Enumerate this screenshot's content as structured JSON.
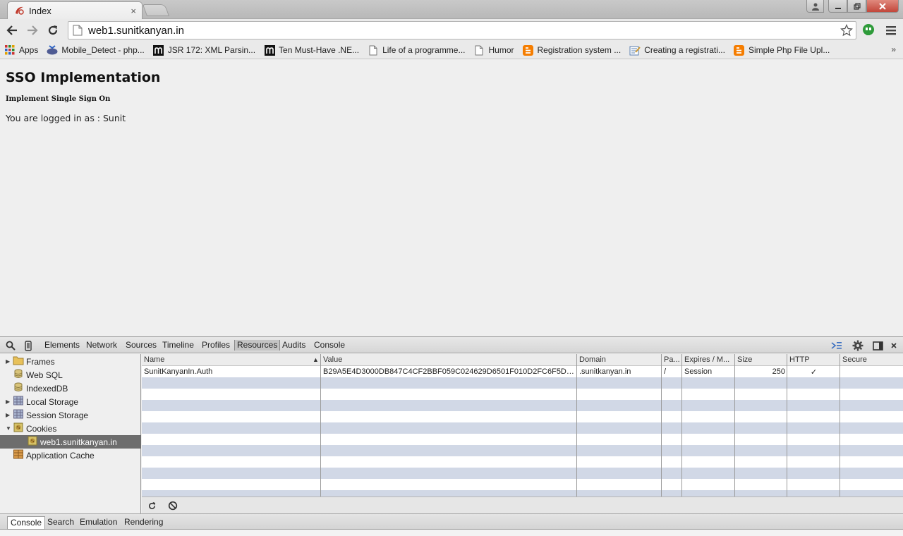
{
  "browser": {
    "tab_title": "Index",
    "tab_close": "×",
    "url": "web1.sunitkanyan.in",
    "bookmarks": [
      {
        "label": "Apps",
        "icon": "apps-icon"
      },
      {
        "label": "Mobile_Detect - php...",
        "icon": "php-icon"
      },
      {
        "label": "JSR 172: XML Parsin...",
        "icon": "m-icon"
      },
      {
        "label": "Ten Must-Have .NE...",
        "icon": "m-icon"
      },
      {
        "label": "Life of a programme...",
        "icon": "page-icon"
      },
      {
        "label": "Humor",
        "icon": "page-icon"
      },
      {
        "label": "Registration system ...",
        "icon": "blogger-icon"
      },
      {
        "label": "Creating a registrati...",
        "icon": "doc-icon"
      },
      {
        "label": "Simple Php File Upl...",
        "icon": "blogger-icon"
      }
    ],
    "bookmarks_overflow": "»",
    "colors": {
      "close_button": "#c2463a",
      "blogger": "#f57d00",
      "selected_row": "#d1d8e6"
    }
  },
  "page": {
    "heading": "SSO Implementation",
    "subheading": "Implement Single Sign On",
    "logged_in_text": "You are logged in as : Sunit"
  },
  "devtools": {
    "tabs": [
      "Elements",
      "Network",
      "Sources",
      "Timeline",
      "Profiles",
      "Resources",
      "Audits",
      "Console"
    ],
    "active_tab": "Resources",
    "sidebar": [
      {
        "label": "Frames",
        "expander": "▶",
        "icon": "folder-icon"
      },
      {
        "label": "Web SQL",
        "expander": "",
        "icon": "database-icon"
      },
      {
        "label": "IndexedDB",
        "expander": "",
        "icon": "database-icon"
      },
      {
        "label": "Local Storage",
        "expander": "▶",
        "icon": "grid-icon"
      },
      {
        "label": "Session Storage",
        "expander": "▶",
        "icon": "grid-icon"
      },
      {
        "label": "Cookies",
        "expander": "▼",
        "icon": "cookie-icon"
      },
      {
        "label": "web1.sunitkanyan.in",
        "expander": "",
        "icon": "cookie-icon"
      },
      {
        "label": "Application Cache",
        "expander": "",
        "icon": "appcache-icon"
      }
    ],
    "cookie_table": {
      "headers": [
        "Name",
        "Value",
        "Domain",
        "Pa...",
        "Expires / M...",
        "Size",
        "HTTP",
        "Secure"
      ],
      "sort_indicator": "▲",
      "rows": [
        [
          "SunitKanyanIn.Auth",
          "B29A5E4D3000DB847C4CF2BBF059C024629D6501F010D2FC6F5DE1B3...",
          ".sunitkanyan.in",
          "/",
          "Session",
          "250",
          "✓",
          ""
        ]
      ]
    },
    "drawer_tabs": [
      "Console",
      "Search",
      "Emulation",
      "Rendering"
    ],
    "active_drawer_tab": "Console"
  }
}
